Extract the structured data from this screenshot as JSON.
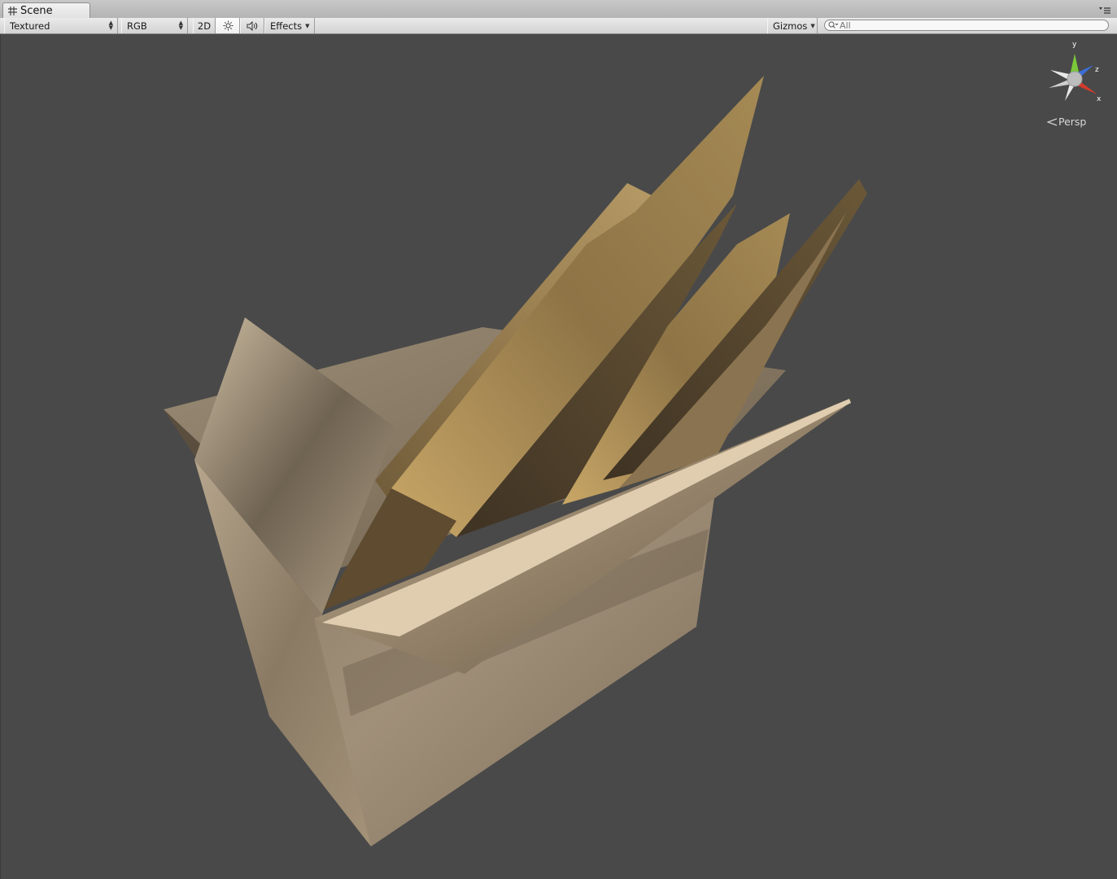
{
  "window": {
    "tab_title": "Scene"
  },
  "toolbar": {
    "render_mode": "Textured",
    "color_mode": "RGB",
    "mode_2d": "2D",
    "effects": "Effects",
    "gizmos": "Gizmos",
    "search_placeholder": "All"
  },
  "gizmo": {
    "y": "y",
    "z": "z",
    "x": "x",
    "projection": "Persp"
  },
  "colors": {
    "viewport_bg": "#494949",
    "axis_y": "#7bc93a",
    "axis_z": "#3b6fd8",
    "axis_x": "#d23b2b"
  }
}
